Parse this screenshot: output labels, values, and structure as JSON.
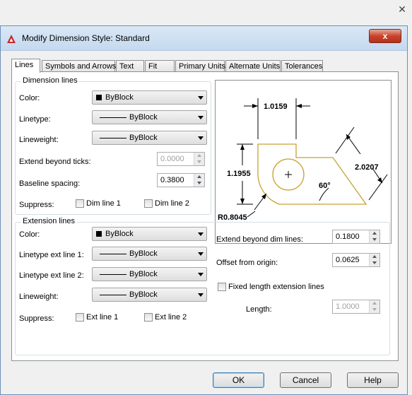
{
  "dialog": {
    "title": "Modify Dimension Style: Standard",
    "close_glyph": "x"
  },
  "outer_close_glyph": "✕",
  "tabs": [
    {
      "label": "Lines",
      "active": true
    },
    {
      "label": "Symbols and Arrows"
    },
    {
      "label": "Text"
    },
    {
      "label": "Fit"
    },
    {
      "label": "Primary Units"
    },
    {
      "label": "Alternate Units"
    },
    {
      "label": "Tolerances"
    }
  ],
  "dimension_lines": {
    "title": "Dimension lines",
    "color_label": "Color:",
    "color_value": "ByBlock",
    "linetype_label": "Linetype:",
    "linetype_value": "ByBlock",
    "lineweight_label": "Lineweight:",
    "lineweight_value": "ByBlock",
    "extend_label": "Extend beyond ticks:",
    "extend_value": "0.0000",
    "baseline_label": "Baseline spacing:",
    "baseline_value": "0.3800",
    "suppress_label": "Suppress:",
    "dim_line1": "Dim line 1",
    "dim_line2": "Dim line 2"
  },
  "extension_lines": {
    "title": "Extension lines",
    "color_label": "Color:",
    "color_value": "ByBlock",
    "linetype1_label": "Linetype ext line 1:",
    "linetype1_value": "ByBlock",
    "linetype2_label": "Linetype ext line 2:",
    "linetype2_value": "ByBlock",
    "lineweight_label": "Lineweight:",
    "lineweight_value": "ByBlock",
    "suppress_label": "Suppress:",
    "ext_line1": "Ext line 1",
    "ext_line2": "Ext line 2",
    "extend_dim_label": "Extend beyond dim lines:",
    "extend_dim_value": "0.1800",
    "offset_label": "Offset from origin:",
    "offset_value": "0.0625",
    "fixed_length_label": "Fixed length extension lines",
    "length_label": "Length:",
    "length_value": "1.0000"
  },
  "preview": {
    "dim_top": "1.0159",
    "dim_left": "1.1955",
    "dim_right": "2.0207",
    "angle": "60°",
    "radius": "R0.8045"
  },
  "buttons": {
    "ok": "OK",
    "cancel": "Cancel",
    "help": "Help"
  },
  "colors": {
    "shape_stroke": "#c8a032",
    "close_red": "#c7432a"
  }
}
